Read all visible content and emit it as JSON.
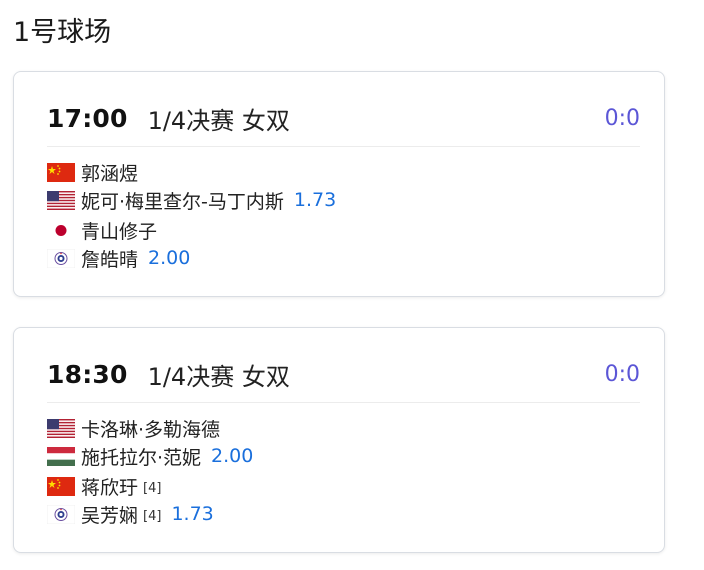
{
  "court": {
    "title": "1号球场"
  },
  "matches": [
    {
      "time": "17:00",
      "round": "1/4决赛 女双",
      "score": "0:0",
      "teams": [
        {
          "odds": "1.73",
          "players": [
            {
              "name": "郭涵煜",
              "flag": "china-flag-icon",
              "seed": ""
            },
            {
              "name": "妮可·梅里查尔-马丁内斯",
              "flag": "usa-flag-icon",
              "seed": ""
            }
          ]
        },
        {
          "odds": "2.00",
          "players": [
            {
              "name": "青山修子",
              "flag": "japan-flag-icon",
              "seed": ""
            },
            {
              "name": "詹皓晴",
              "flag": "chinese-taipei-flag-icon",
              "seed": ""
            }
          ]
        }
      ]
    },
    {
      "time": "18:30",
      "round": "1/4决赛 女双",
      "score": "0:0",
      "teams": [
        {
          "odds": "2.00",
          "players": [
            {
              "name": "卡洛琳·多勒海德",
              "flag": "usa-flag-icon",
              "seed": ""
            },
            {
              "name": "施托拉尔·范妮",
              "flag": "hungary-flag-icon",
              "seed": ""
            }
          ]
        },
        {
          "odds": "1.73",
          "players": [
            {
              "name": "蒋欣玗",
              "flag": "china-flag-icon",
              "seed": "[4]"
            },
            {
              "name": "吴芳娴",
              "flag": "chinese-taipei-flag-icon",
              "seed": "[4]"
            }
          ]
        }
      ]
    }
  ],
  "colors": {
    "score": "#5b56d6",
    "odds": "#1a6fdc"
  }
}
